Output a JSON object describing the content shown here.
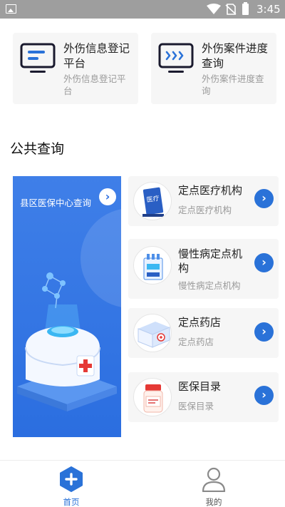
{
  "status_bar": {
    "time": "3:45"
  },
  "quick_links": [
    {
      "title": "外伤信息登记平台",
      "subtitle": "外伤信息登记平台"
    },
    {
      "title": "外伤案件进度查询",
      "subtitle": "外伤案件进度查询"
    }
  ],
  "section": {
    "title": "公共查询"
  },
  "promo": {
    "label": "县区医保中心查询"
  },
  "services": [
    {
      "title": "定点医疗机构",
      "subtitle": "定点医疗机构",
      "icon": "hospital-sign-icon",
      "icon_text": "医疗"
    },
    {
      "title": "慢性病定点机构",
      "subtitle": "慢性病定点机构",
      "icon": "medicine-machine-icon"
    },
    {
      "title": "定点药店",
      "subtitle": "定点药店",
      "icon": "medicine-box-icon"
    },
    {
      "title": "医保目录",
      "subtitle": "医保目录",
      "icon": "pill-bottle-icon"
    }
  ],
  "tabbar": {
    "home": "首页",
    "mine": "我的"
  },
  "colors": {
    "accent": "#2a72d8",
    "card_bg": "#f6f6f6",
    "promo_bg": "#2b6ee0"
  }
}
